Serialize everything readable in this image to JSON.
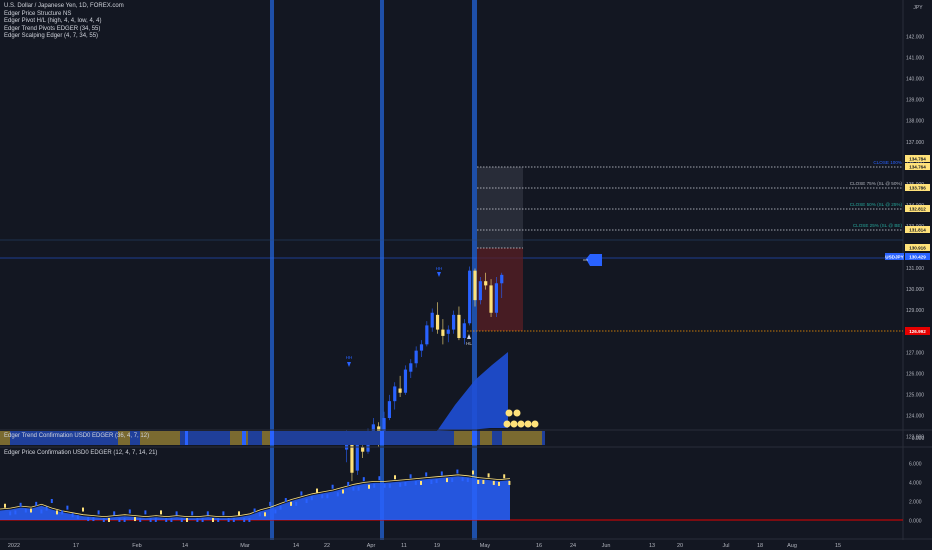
{
  "chart_title": "U.S. Dollar / Japanese Yen, 1D, FOREX.com",
  "indicators": [
    "Edger Price Structure NS",
    "Edger Pivot H/L (high, 4, 4, low, 4, 4)",
    "Edger Trend Pivots EDGER (34, 55)",
    "Edger Scalping Edger (4, 7, 34, 55)"
  ],
  "currency": "JPY",
  "trend_pane_title": "Edger Trend Confirmation USD0 EDGER (36, 4, 7, 12)",
  "trend_pane_value": "0.000",
  "price_pane_title": "Edger Price Confirmation USD0 EDGER (12, 4, 7, 14, 21)",
  "price_axis": [
    "142.000",
    "141.000",
    "140.000",
    "139.000",
    "138.000",
    "137.000",
    "136.000",
    "135.000",
    "134.000",
    "133.000",
    "132.000",
    "131.000",
    "130.000",
    "129.000",
    "128.000",
    "127.000",
    "126.000",
    "125.000",
    "124.000",
    "123.000"
  ],
  "lower_axis": [
    "6.000",
    "4.000",
    "2.000",
    "0.000"
  ],
  "x_labels": [
    "2022",
    "17",
    "Feb",
    "14",
    "Mar",
    "14",
    "22",
    "Apr",
    "11",
    "19",
    "May",
    "16",
    "24",
    "Jun",
    "13",
    "20",
    "Jul",
    "18",
    "Aug",
    "15"
  ],
  "levels": {
    "close100": {
      "label": "CLOSE 100%",
      "value": "134.784",
      "value2": "134.764"
    },
    "close75": {
      "label": "CLOSE 75% (SL @ 50%)",
      "value": "133.786"
    },
    "close50": {
      "label": "CLOSE 50% (SL @ 25%)",
      "value": "132.812"
    },
    "close25": {
      "label": "CLOSE 25% (SL @ BE)",
      "value": "131.814"
    },
    "entry": {
      "value": "130.916"
    },
    "current": {
      "label": "USDJPY",
      "value": "130.429"
    },
    "stop": {
      "value": "126.992"
    }
  },
  "marker_labels": {
    "pivot_high_a": "HH",
    "pivot_high_b": "HH",
    "pivot_low": "HL"
  },
  "colors": {
    "background": "#131722",
    "bull": "#2962ff",
    "bear": "#ffe27a",
    "vband": "#1e4fa8",
    "stop": "#ff2020",
    "trend_bull": "#1f3f9a",
    "trend_bear": "#7a6a30"
  },
  "chart_data": {
    "type": "candlestick",
    "title": "U.S. Dollar / Japanese Yen, 1D, FOREX.com",
    "ylim": [
      122.5,
      142.5
    ],
    "grid": false,
    "candles": [
      [
        122.4,
        123.3,
        121.8,
        123.0,
        "bull"
      ],
      [
        123.0,
        123.1,
        120.9,
        121.3,
        "bear"
      ],
      [
        121.4,
        122.9,
        121.2,
        122.7,
        "bull"
      ],
      [
        122.5,
        122.6,
        122.0,
        122.3,
        "bear"
      ],
      [
        122.3,
        123.4,
        122.2,
        123.2,
        "bull"
      ],
      [
        123.2,
        123.9,
        123.0,
        123.6,
        "bull"
      ],
      [
        123.5,
        123.7,
        122.5,
        122.8,
        "bear"
      ],
      [
        122.9,
        124.2,
        122.7,
        123.9,
        "bull"
      ],
      [
        123.9,
        125.0,
        123.8,
        124.7,
        "bull"
      ],
      [
        124.7,
        125.6,
        124.3,
        125.4,
        "bull"
      ],
      [
        125.3,
        125.9,
        124.9,
        125.1,
        "bear"
      ],
      [
        125.1,
        126.4,
        125.0,
        126.2,
        "bull"
      ],
      [
        126.1,
        126.7,
        125.8,
        126.5,
        "bull"
      ],
      [
        126.5,
        127.3,
        126.3,
        127.1,
        "bull"
      ],
      [
        127.1,
        127.6,
        126.8,
        127.4,
        "bull"
      ],
      [
        127.4,
        128.5,
        127.3,
        128.3,
        "bull"
      ],
      [
        128.2,
        129.1,
        128.0,
        128.9,
        "bull"
      ],
      [
        128.8,
        129.4,
        127.9,
        128.1,
        "bear"
      ],
      [
        128.1,
        128.6,
        127.4,
        127.8,
        "bear"
      ],
      [
        127.9,
        128.3,
        127.5,
        128.1,
        "bull"
      ],
      [
        128.1,
        129.0,
        127.9,
        128.8,
        "bull"
      ],
      [
        128.8,
        129.2,
        127.6,
        127.7,
        "bear"
      ],
      [
        127.7,
        128.6,
        127.4,
        128.4,
        "bull"
      ],
      [
        128.4,
        131.1,
        128.3,
        130.9,
        "bull"
      ],
      [
        130.9,
        131.0,
        129.2,
        129.5,
        "bear"
      ],
      [
        129.5,
        130.6,
        129.3,
        130.4,
        "bull"
      ],
      [
        130.4,
        130.8,
        130.0,
        130.2,
        "bear"
      ],
      [
        130.2,
        130.5,
        128.7,
        128.9,
        "bear"
      ],
      [
        128.9,
        130.6,
        128.7,
        130.3,
        "bull"
      ],
      [
        130.3,
        130.8,
        129.6,
        130.7,
        "bull"
      ]
    ]
  }
}
